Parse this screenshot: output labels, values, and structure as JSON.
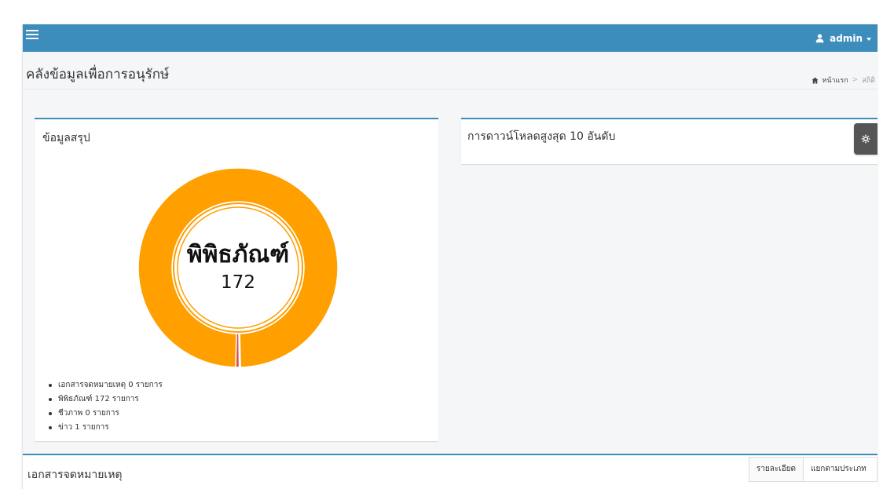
{
  "app": {
    "title": "คลังข้อมูลเพื่อการอนุรักษ์"
  },
  "topbar": {
    "user_label": "admin"
  },
  "breadcrumb": {
    "home_label": "หน้าแรก",
    "separator": ">",
    "current_label": "สถิติ"
  },
  "summary_box": {
    "title": "ข้อมูลสรุป",
    "center_label": "พิพิธภัณฑ์",
    "center_value": "172"
  },
  "top_downloads_box": {
    "title": "การดาวน์โหลดสูงสุด 10 อันดับ"
  },
  "bottom_section": {
    "title": "เอกสารจดหมายเหตุ",
    "tabs": [
      {
        "label": "รายละเอียด"
      },
      {
        "label": "แยกตามประเภท"
      }
    ]
  },
  "icons": {
    "menu": "hamburger-icon",
    "user": "user-icon",
    "home": "home-icon",
    "settings": "gear-icon"
  },
  "colors": {
    "header_bg": "#3c8dbc",
    "accent_orange": "#ff9f00",
    "dark_button": "#555555",
    "slice_blue": "#2f7ed8",
    "slice_black": "#111111",
    "slice_red": "#d9534f"
  },
  "chart_data": {
    "type": "pie",
    "categories": [
      "เอกสารจดหมายเหตุ",
      "พิพิธภัณฑ์",
      "ชีวภาพ",
      "ข่าว"
    ],
    "values": [
      0,
      172,
      0,
      1
    ],
    "unit": "รายการ",
    "legend": [
      "เอกสารจดหมายเหตุ 0 รายการ",
      "พิพิธภัณฑ์ 172 รายการ",
      "ชีวภาพ 0 รายการ",
      "ข่าว 1 รายการ"
    ],
    "colors": [
      "#2f7ed8",
      "#ff9f00",
      "#111111",
      "#d9534f"
    ]
  }
}
